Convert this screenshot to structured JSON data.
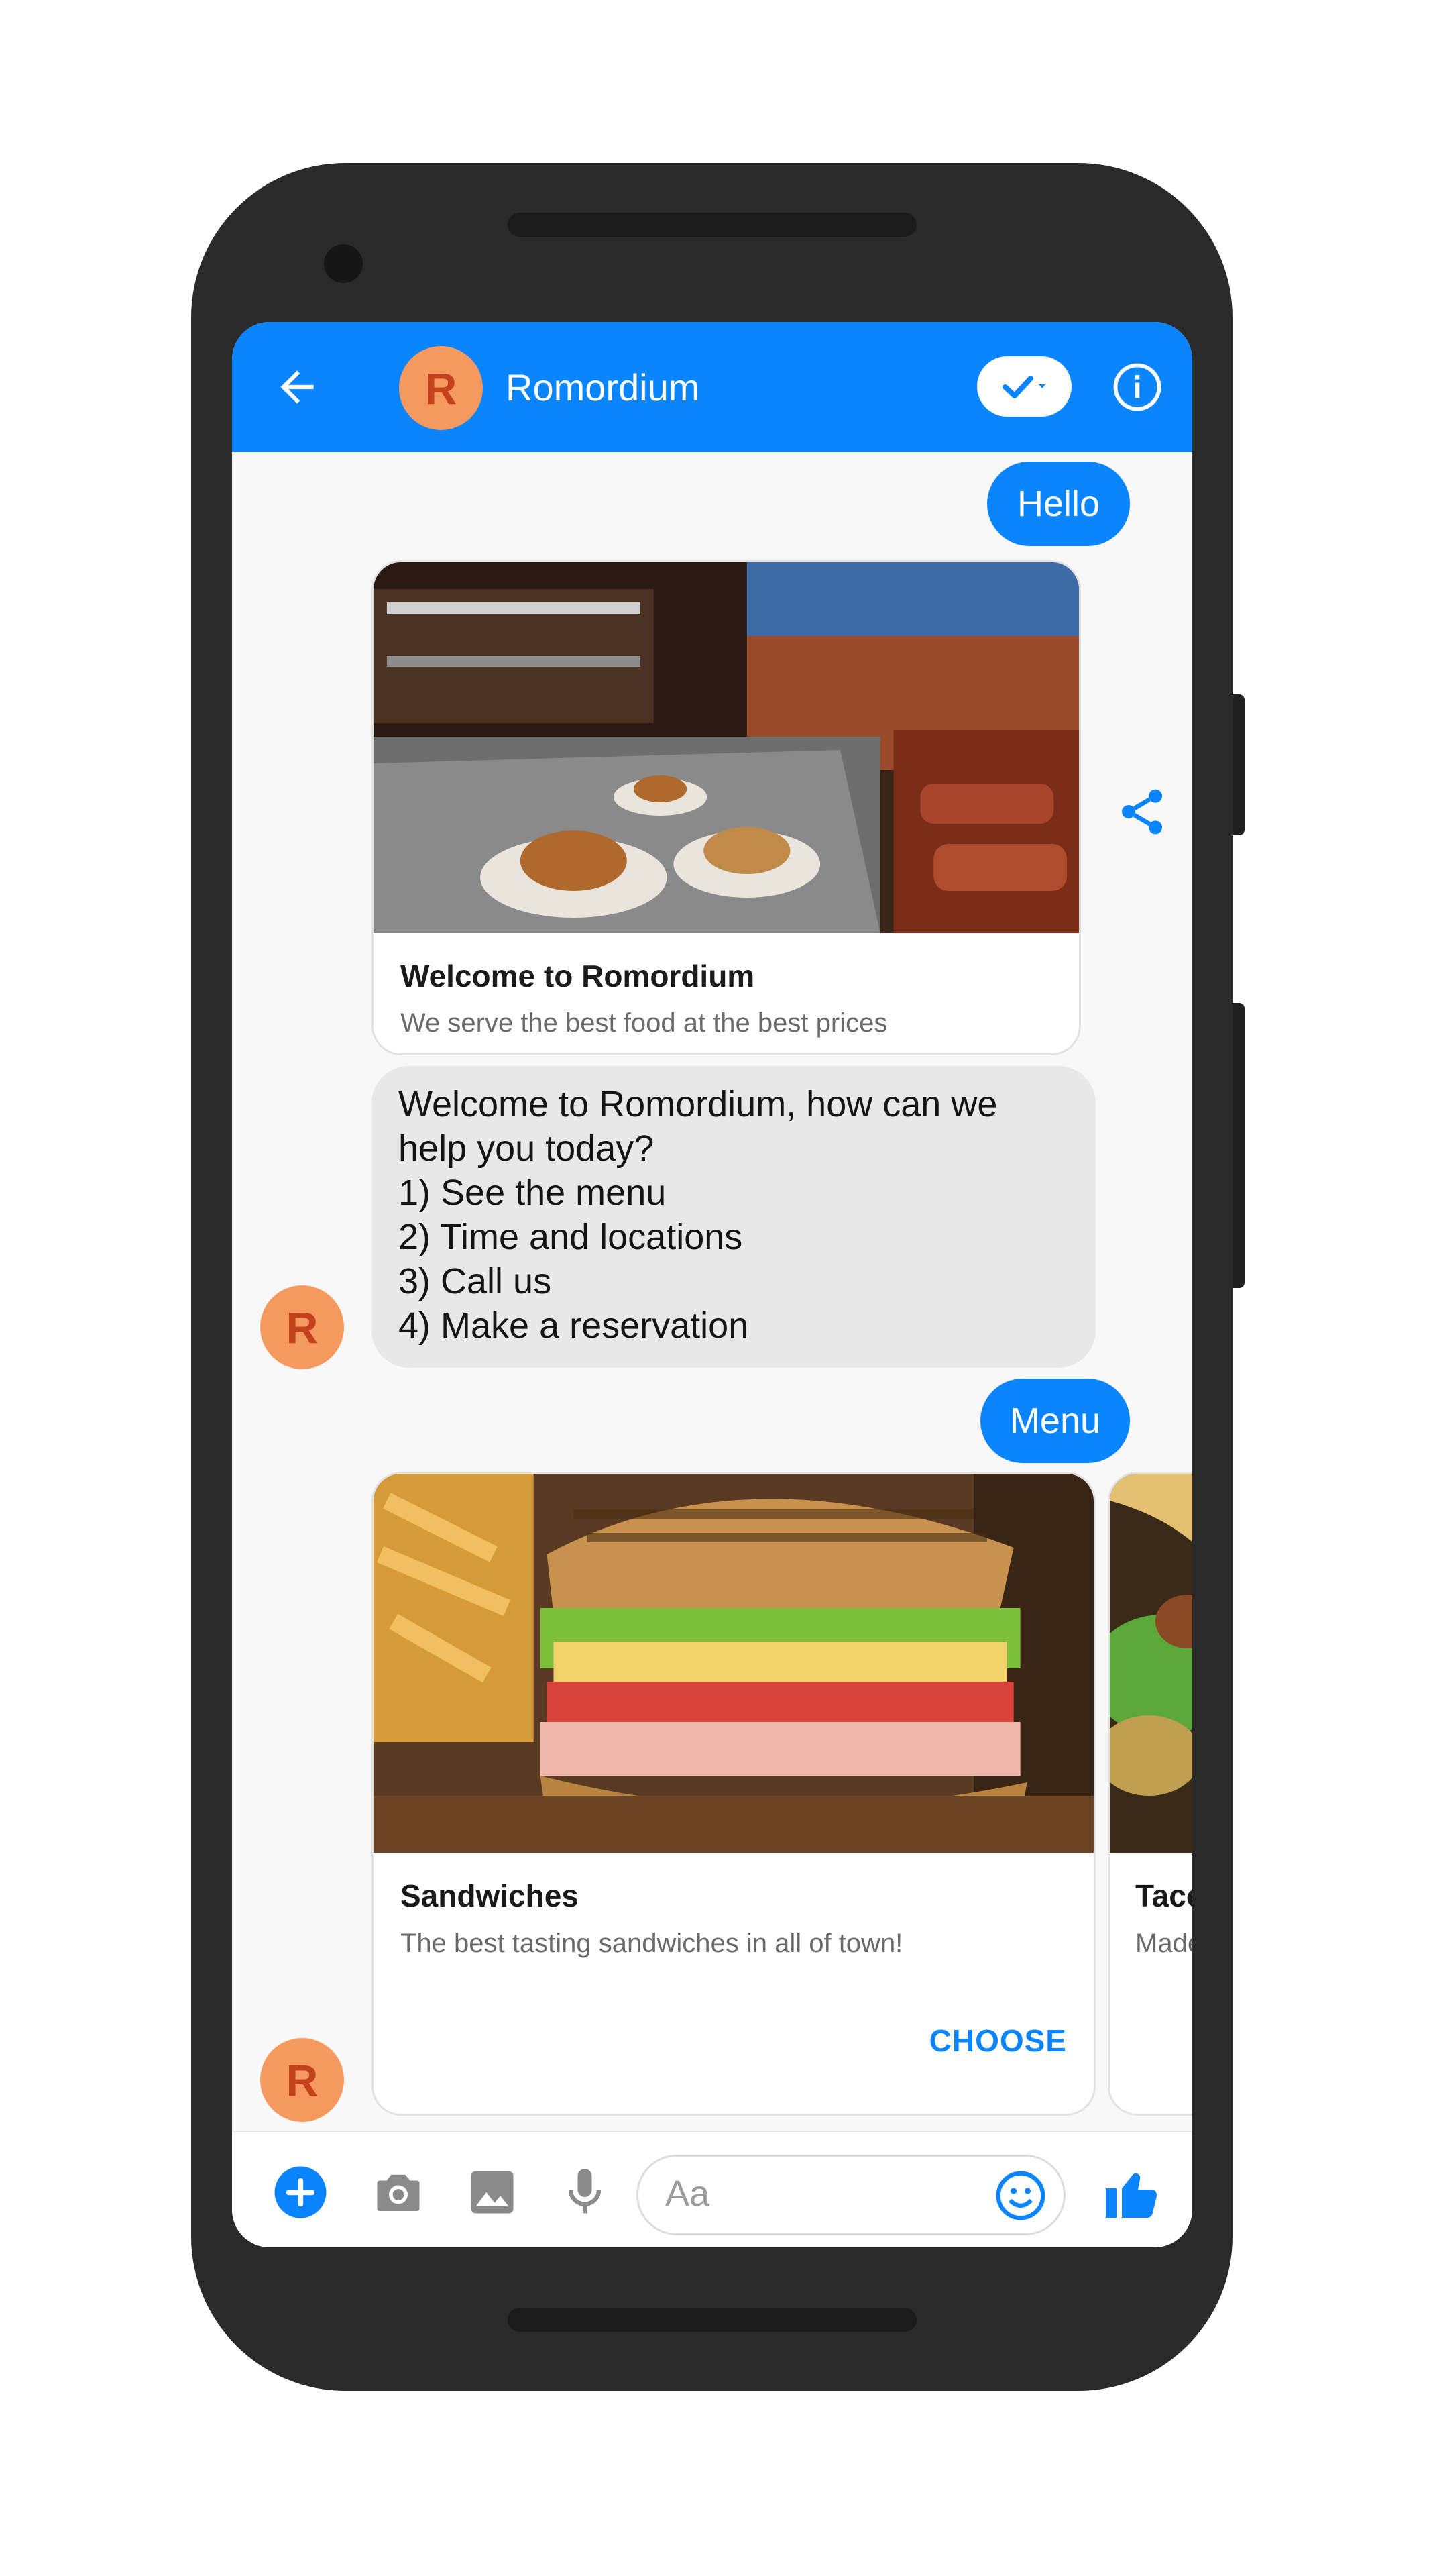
{
  "header": {
    "title": "Romordium",
    "avatar_initial": "R"
  },
  "messages": {
    "hello": "Hello",
    "welcome_card": {
      "title": "Welcome to Romordium",
      "subtitle": "We serve the best food at the best prices"
    },
    "bot_reply": {
      "lines": [
        "Welcome to Romordium, how can we",
        "help you today?",
        "1) See the menu",
        "2) Time and locations",
        "3) Call us",
        "4) Make a reservation"
      ]
    },
    "menu": "Menu",
    "bot_avatar_initial": "R"
  },
  "carousel": {
    "items": [
      {
        "title": "Sandwiches",
        "subtitle": "The best tasting sandwiches in all of town!",
        "button": "CHOOSE"
      },
      {
        "title": "Taco",
        "subtitle": "Made"
      }
    ]
  },
  "composer": {
    "placeholder": "Aa"
  },
  "colors": {
    "brand_blue": "#0a84ff",
    "avatar_orange": "#f6995f",
    "avatar_text": "#c3421c"
  }
}
